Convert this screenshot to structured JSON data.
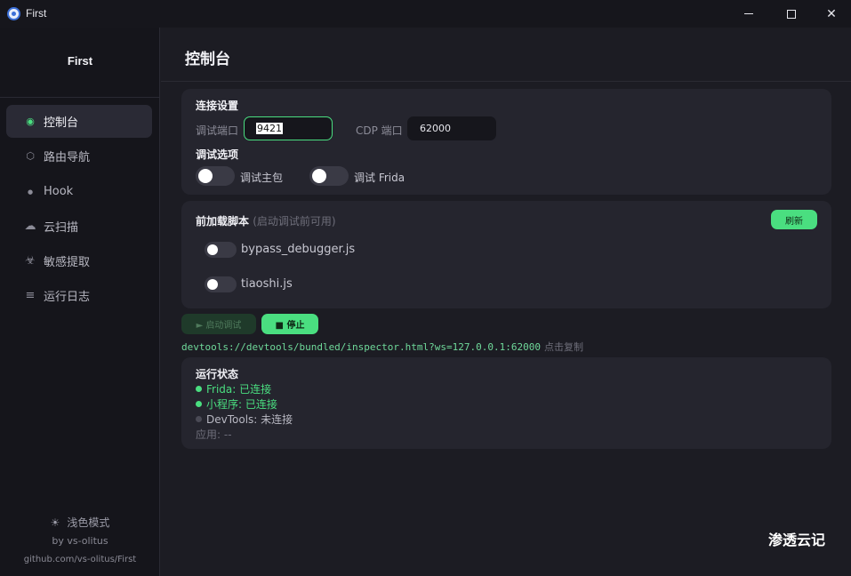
{
  "window": {
    "title": "First",
    "minimize_label": "",
    "close_glyph": "✕"
  },
  "sidebar": {
    "brand": "First",
    "items": [
      {
        "label": "控制台",
        "icon": "dot-icon",
        "active": true
      },
      {
        "label": "路由导航",
        "icon": "hexagon-icon",
        "active": false
      },
      {
        "label": "Hook",
        "icon": "small-dot-icon",
        "active": false
      },
      {
        "label": "云扫描",
        "icon": "cloud-icon",
        "active": false
      },
      {
        "label": "敏感提取",
        "icon": "biohazard-icon",
        "active": false
      },
      {
        "label": "运行日志",
        "icon": "menu-lines-icon",
        "active": false
      }
    ],
    "icon_glyphs": [
      "◉",
      "⬡",
      "●",
      "☁",
      "☣",
      "≡"
    ],
    "theme_toggle": "浅色模式",
    "theme_icon": "☀",
    "author": "by vs-olitus",
    "repo": "github.com/vs-olitus/First"
  },
  "main": {
    "title": "控制台",
    "connection": {
      "section": "连接设置",
      "debug_port_label": "调试端口",
      "debug_port_value": "9421",
      "cdp_port_label": "CDP 端口",
      "cdp_port_value": "62000",
      "options_section": "调试选项",
      "toggle_main": "调试主包",
      "toggle_frida": "调试 Frida"
    },
    "scripts": {
      "section": "前加载脚本",
      "hint": "(启动调试前可用)",
      "refresh": "刷新",
      "items": [
        "bypass_debugger.js",
        "tiaoshi.js"
      ]
    },
    "actions": {
      "start": "► 启动调试",
      "stop": "■  停止"
    },
    "devtools_url": "devtools://devtools/bundled/inspector.html?ws=127.0.0.1:62000",
    "copy_hint": "点击复制",
    "status": {
      "section": "运行状态",
      "frida": "Frida: 已连接",
      "miniprogram": "小程序: 已连接",
      "devtools": "DevTools: 未连接",
      "app": "应用: --"
    }
  },
  "watermark": "渗透云记",
  "colors": {
    "accent": "#4ade80",
    "bg": "#1c1c23",
    "card": "#25252e",
    "sidebar": "#15151b"
  }
}
